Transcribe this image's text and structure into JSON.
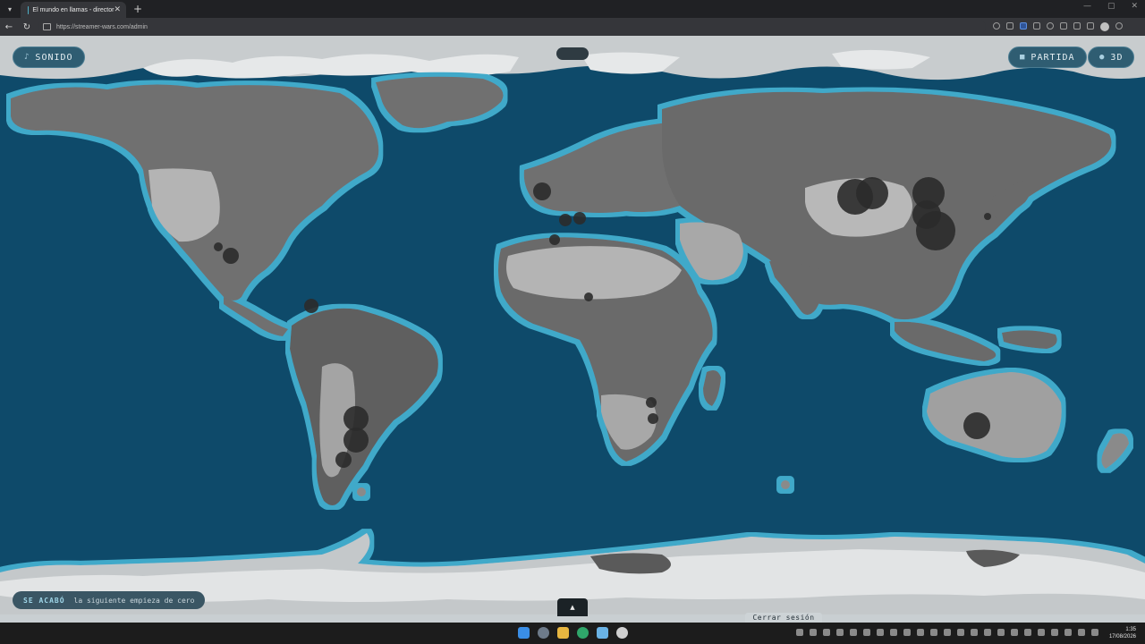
{
  "browser": {
    "tab_title": "El mundo en llamas - director",
    "tab_close": "✕",
    "new_tab": "+",
    "url": "https://streamer-wars.com/admin",
    "window_controls": [
      "—",
      "▢",
      "✕"
    ]
  },
  "map_controls": {
    "sound_label": "SONIDO",
    "sound_icon": "♪",
    "game_label": "PARTIDA",
    "game_icon": "■",
    "view3d_label": "3D",
    "view3d_icon": "●"
  },
  "status": {
    "strong": "SE ACABÓ",
    "text": "la siguiente empieza de cero"
  },
  "footer": {
    "expand_icon": "▲",
    "logout_label": "Cerrar sesión"
  },
  "taskbar": {
    "clock_time": "1:35",
    "clock_date": "17/08/2026"
  },
  "colors": {
    "ocean": "#0e4a6a",
    "coast_glow": "#3fa9c9",
    "land": "#6f6f6f",
    "land_light": "#b4b4b4",
    "ice": "#d9dcdd",
    "hotspot": "#2b2b2b"
  }
}
